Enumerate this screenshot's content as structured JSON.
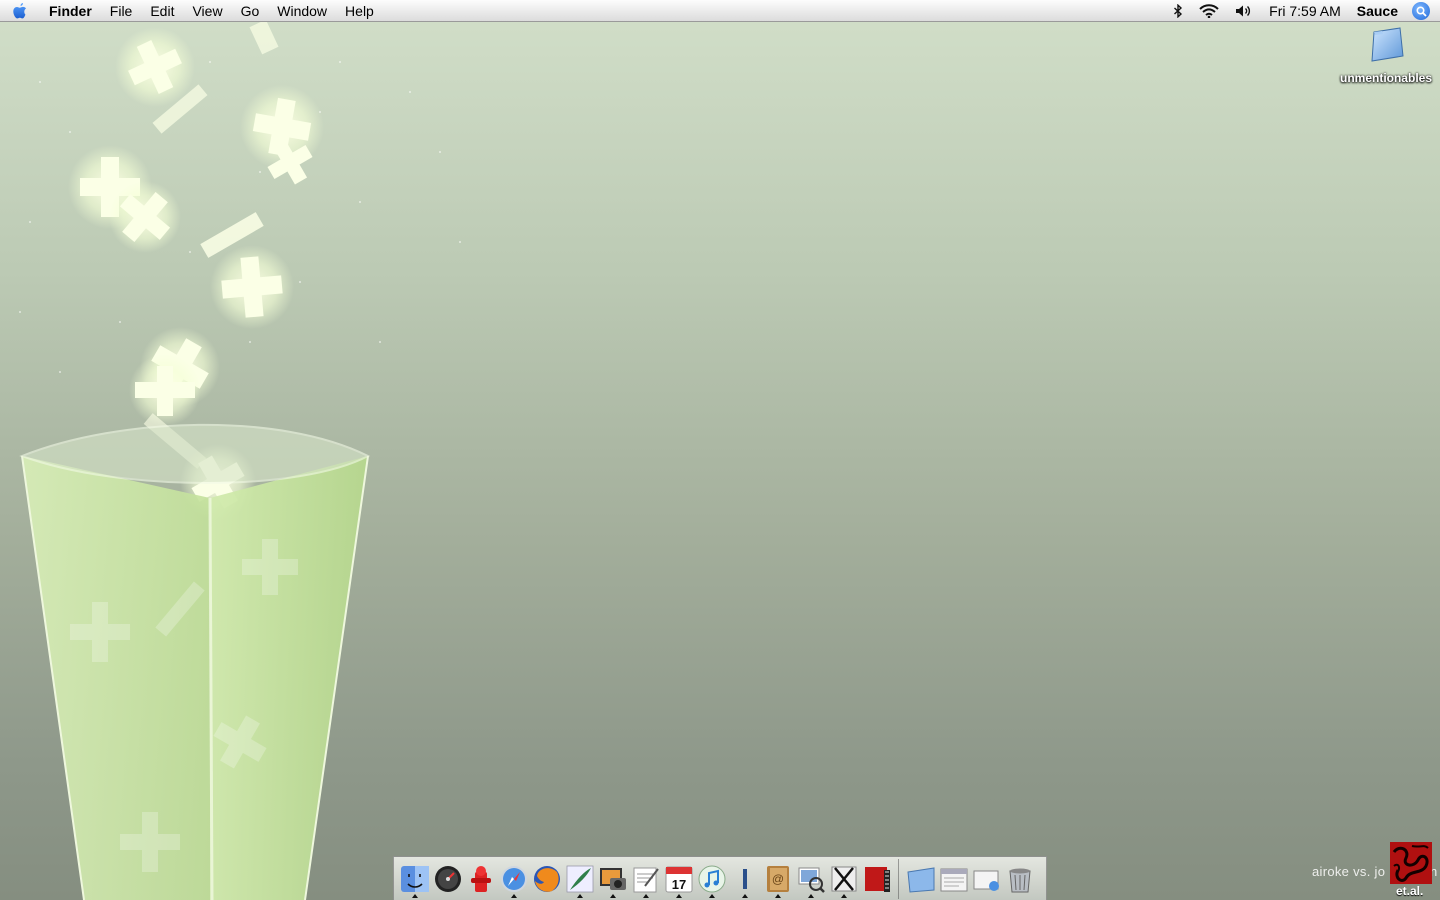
{
  "menubar": {
    "apple_icon": "apple-icon",
    "app_name": "Finder",
    "menus": [
      "File",
      "Edit",
      "View",
      "Go",
      "Window",
      "Help"
    ],
    "status": {
      "bluetooth_icon": "bluetooth-icon",
      "wifi_icon": "wifi-icon",
      "volume_icon": "volume-icon",
      "clock": "Fri 7:59 AM",
      "user": "Sauce",
      "spotlight_icon": "spotlight-icon"
    }
  },
  "desktop": {
    "folder_label": "unmentionables"
  },
  "dock": {
    "apps": [
      {
        "name": "finder",
        "running": true
      },
      {
        "name": "dashboard",
        "running": false
      },
      {
        "name": "fire-hydrant",
        "running": false
      },
      {
        "name": "safari",
        "running": true
      },
      {
        "name": "firefox",
        "running": false
      },
      {
        "name": "quill",
        "running": true
      },
      {
        "name": "iphoto",
        "running": true
      },
      {
        "name": "textedit",
        "running": true
      },
      {
        "name": "ical",
        "running": true
      },
      {
        "name": "itunes",
        "running": true
      },
      {
        "name": "terminal-bar",
        "running": true
      },
      {
        "name": "address-book",
        "running": true
      },
      {
        "name": "preview",
        "running": true
      },
      {
        "name": "x11",
        "running": true
      },
      {
        "name": "red-app",
        "running": true
      }
    ],
    "stacks": [
      "folder",
      "documents",
      "network",
      "trash"
    ]
  },
  "watermark": {
    "text": "airoke vs. jo",
    "trailing": "n",
    "badge": "et.al."
  },
  "colors": {
    "menubar": "#ececec",
    "desktop_top": "#d2dfc9",
    "desktop_bottom": "#858e80",
    "cup_green": "#c8e6a0",
    "spotlight_blue": "#1e68d8"
  }
}
